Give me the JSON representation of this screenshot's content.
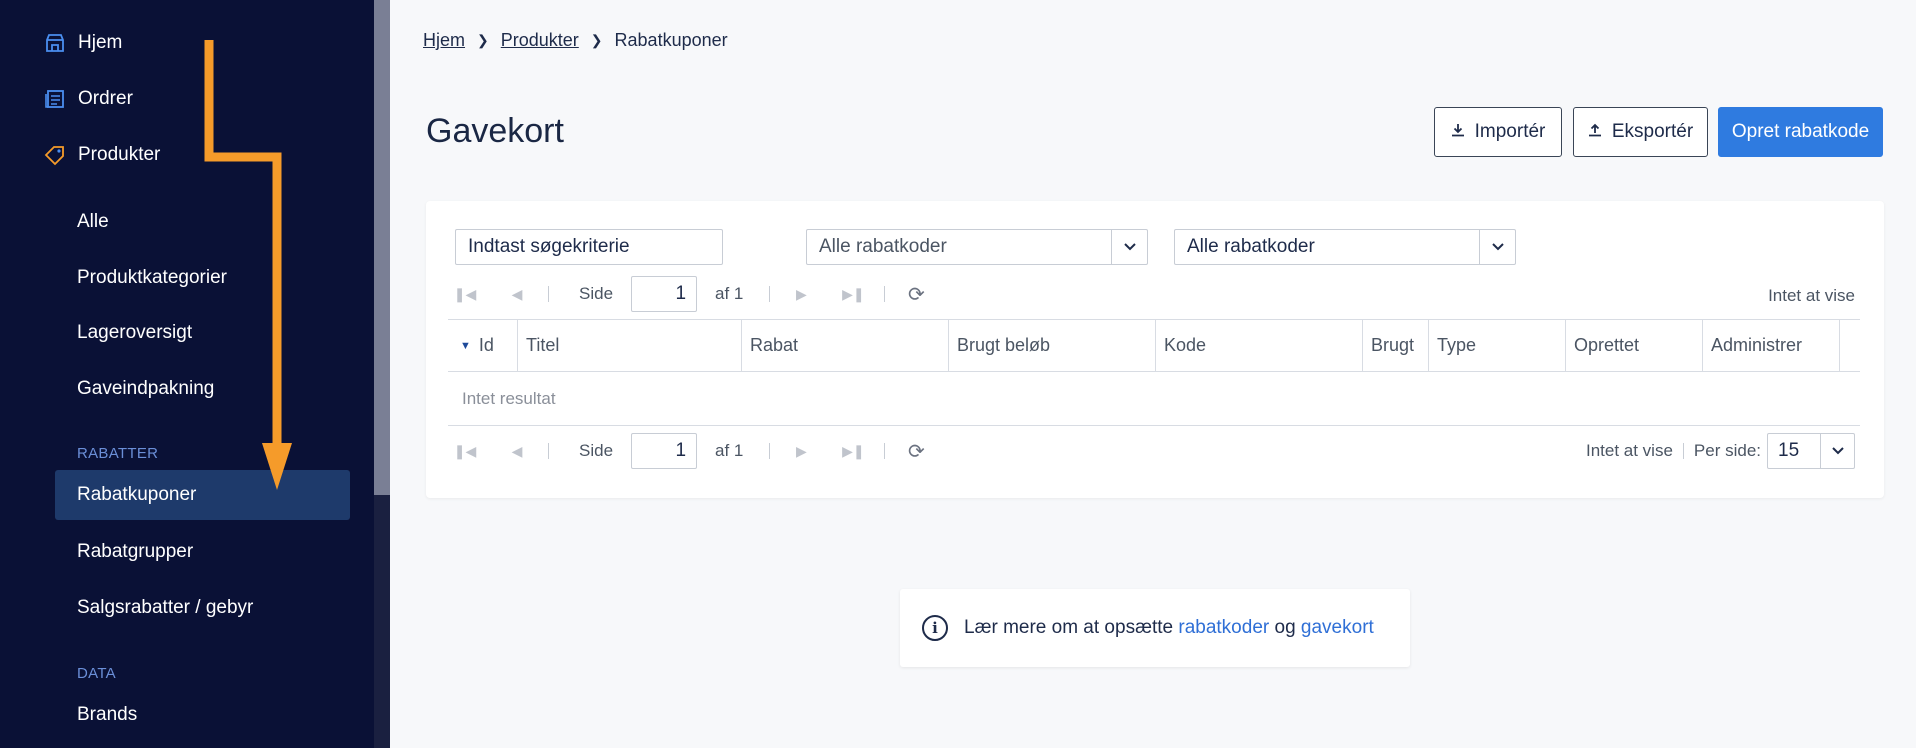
{
  "sidebar": {
    "main_items": [
      {
        "label": "Hjem",
        "icon": "shop-icon"
      },
      {
        "label": "Ordrer",
        "icon": "orders-icon"
      },
      {
        "label": "Produkter",
        "icon": "tag-icon"
      }
    ],
    "product_items": [
      "Alle",
      "Produktkategorier",
      "Lageroversigt",
      "Gaveindpakning"
    ],
    "section_discounts": "RABATTER",
    "discount_items": [
      "Rabatkuponer",
      "Rabatgrupper",
      "Salgsrabatter / gebyr"
    ],
    "section_data": "DATA",
    "data_items": [
      "Brands"
    ],
    "active_item": "Rabatkuponer",
    "annotation_arrow_color": "#f59b2a"
  },
  "breadcrumb": {
    "home": "Hjem",
    "products": "Produkter",
    "current": "Rabatkuponer"
  },
  "page": {
    "title": "Gavekort"
  },
  "toolbar": {
    "import_label": "Importér",
    "export_label": "Eksportér",
    "create_label": "Opret rabatkode"
  },
  "filters": {
    "search_value": "Indtast søgekriterie",
    "select1_value": "Alle rabatkoder",
    "select2_value": "Alle rabatkoder"
  },
  "pager_top": {
    "page_label": "Side",
    "page_value": "1",
    "of_label": "af 1",
    "info": "Intet at vise"
  },
  "table": {
    "columns": [
      "Id",
      "Titel",
      "Rabat",
      "Brugt beløb",
      "Kode",
      "Brugt",
      "Type",
      "Oprettet",
      "Administrer"
    ],
    "empty_text": "Intet resultat"
  },
  "pager_bottom": {
    "page_label": "Side",
    "page_value": "1",
    "of_label": "af 1",
    "info": "Intet at vise",
    "per_page_label": "Per side:",
    "per_page_value": "15"
  },
  "info_box": {
    "text_before": "Lær mere om at opsætte",
    "link1": "rabatkoder",
    "text_mid": "og",
    "link2": "gavekort"
  },
  "colors": {
    "sidebar_bg": "#0a1136",
    "active_bg": "#1e3a6b",
    "accent": "#2f7be0",
    "icon_blue": "#4a8ef0",
    "icon_orange": "#f59b2a"
  }
}
